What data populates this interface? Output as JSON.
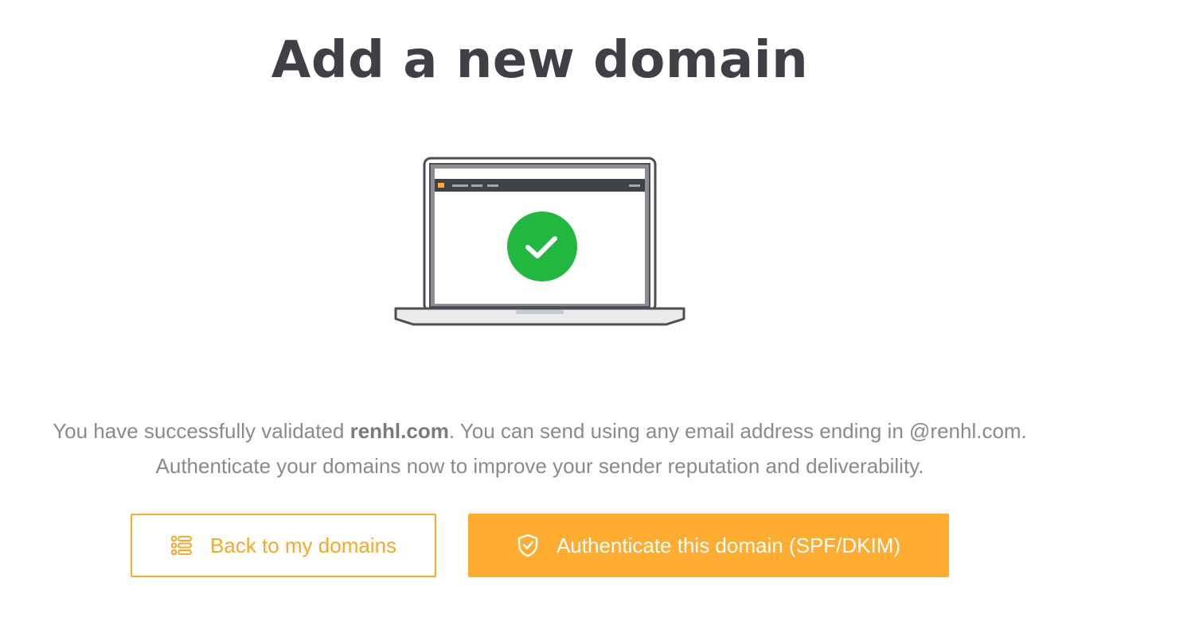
{
  "page": {
    "title": "Add a new domain"
  },
  "message": {
    "line1_prefix": "You have successfully validated ",
    "domain": "renhl.com",
    "line1_suffix": ". You can send using any email address ending in @renhl.com.",
    "line2": "Authenticate your domains now to improve your sender reputation and deliverability."
  },
  "buttons": {
    "back_label": "Back to my domains",
    "back_icon": "list-icon",
    "authenticate_label": "Authenticate this domain (SPF/DKIM)",
    "authenticate_icon": "shield-check-icon"
  },
  "illustration": {
    "icon": "laptop-success-icon",
    "status_icon": "check-icon",
    "status_color": "#22b83f"
  },
  "colors": {
    "accent": "#ffac30",
    "title": "#3f4046",
    "text": "#8a8a8a",
    "success": "#22b83f"
  }
}
